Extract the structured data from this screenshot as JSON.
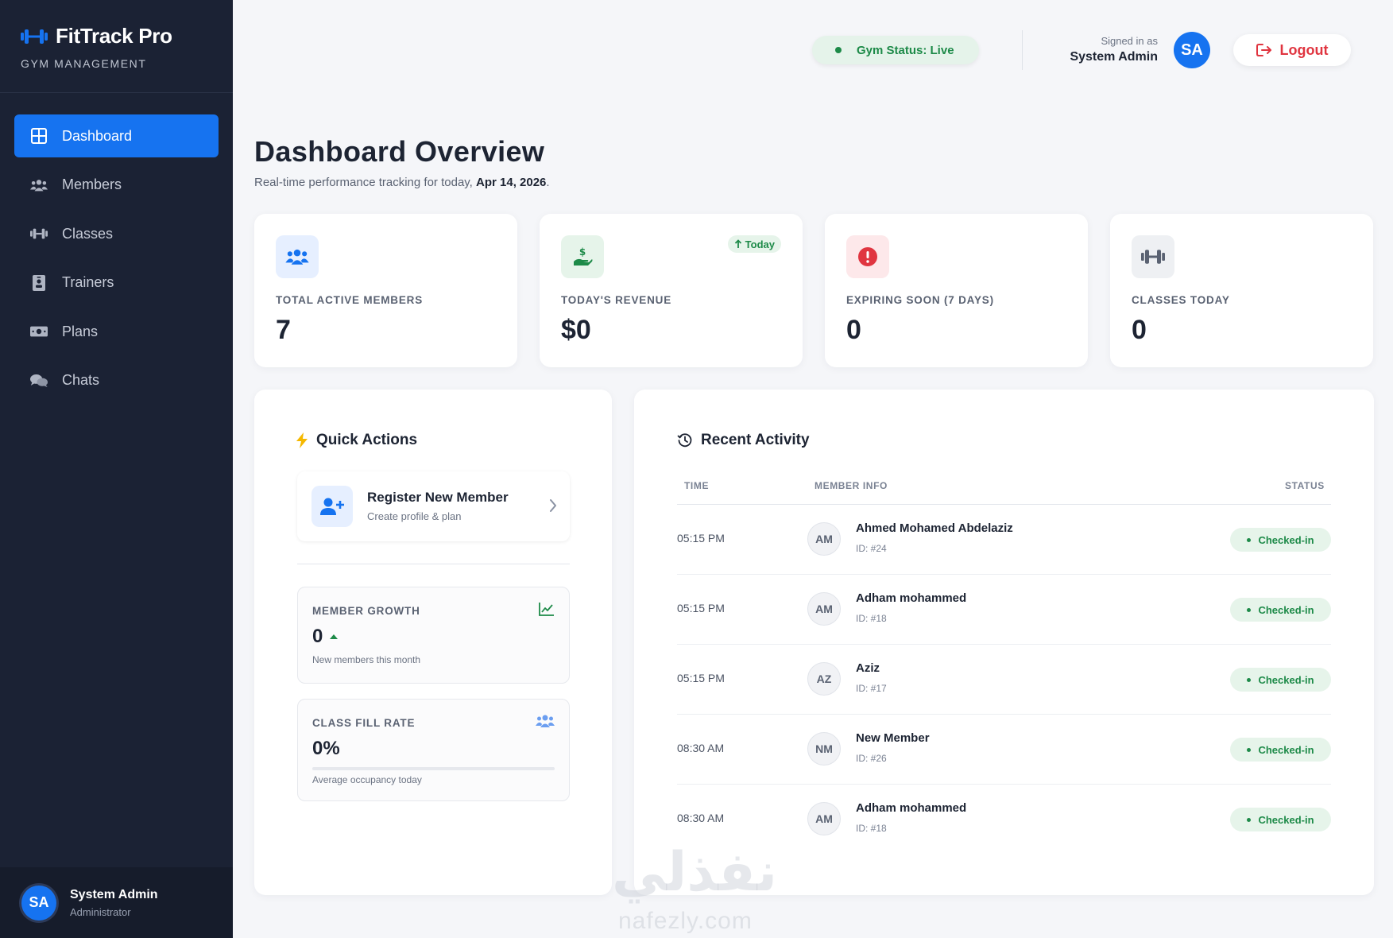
{
  "brand": {
    "title": "FitTrack Pro",
    "subtitle": "GYM MANAGEMENT"
  },
  "sidebar": {
    "items": [
      {
        "label": "Dashboard",
        "icon": "dashboard-icon",
        "active": true
      },
      {
        "label": "Members",
        "icon": "users-icon"
      },
      {
        "label": "Classes",
        "icon": "dumbbell-icon"
      },
      {
        "label": "Trainers",
        "icon": "id-badge-icon"
      },
      {
        "label": "Plans",
        "icon": "money-bill-icon"
      },
      {
        "label": "Chats",
        "icon": "comments-icon"
      }
    ],
    "user": {
      "initials": "SA",
      "name": "System Admin",
      "role": "Administrator"
    }
  },
  "header": {
    "gym_status": "Gym Status: Live",
    "signed_in_label": "Signed in as",
    "user_name": "System Admin",
    "initials": "SA",
    "logout_label": "Logout"
  },
  "page": {
    "title": "Dashboard Overview",
    "subtitle_prefix": "Real-time performance tracking for today,",
    "date": "Apr 14, 2026",
    "subtitle_suffix": "."
  },
  "stats": [
    {
      "label": "TOTAL ACTIVE MEMBERS",
      "value": "7",
      "icon": "users-icon",
      "color": "#1673f0"
    },
    {
      "label": "TODAY'S REVENUE",
      "value": "$0",
      "icon": "money-hand-icon",
      "color": "#1d8a48",
      "badge": "Today"
    },
    {
      "label": "EXPIRING SOON (7 DAYS)",
      "value": "0",
      "icon": "alert-icon",
      "color": "#e03540"
    },
    {
      "label": "CLASSES TODAY",
      "value": "0",
      "icon": "dumbbell-icon",
      "color": "#5a6272"
    }
  ],
  "quick_actions": {
    "title": "Quick Actions",
    "register": {
      "title": "Register New Member",
      "subtitle": "Create profile & plan"
    },
    "member_growth": {
      "label": "MEMBER GROWTH",
      "value": "0",
      "subtitle": "New members this month"
    },
    "class_fill": {
      "label": "CLASS FILL RATE",
      "value": "0%",
      "subtitle": "Average occupancy today",
      "progress": 0
    }
  },
  "recent_activity": {
    "title": "Recent Activity",
    "columns": [
      "TIME",
      "MEMBER INFO",
      "STATUS"
    ],
    "rows": [
      {
        "time": "05:15 PM",
        "initials": "AM",
        "name": "Ahmed Mohamed Abdelaziz",
        "id": "ID: #24",
        "status": "Checked-in"
      },
      {
        "time": "05:15 PM",
        "initials": "AM",
        "name": "Adham mohammed",
        "id": "ID: #18",
        "status": "Checked-in"
      },
      {
        "time": "05:15 PM",
        "initials": "AZ",
        "name": "Aziz",
        "id": "ID: #17",
        "status": "Checked-in"
      },
      {
        "time": "08:30 AM",
        "initials": "NM",
        "name": "New Member",
        "id": "ID: #26",
        "status": "Checked-in"
      },
      {
        "time": "08:30 AM",
        "initials": "AM",
        "name": "Adham mohammed",
        "id": "ID: #18",
        "status": "Checked-in"
      }
    ]
  },
  "watermark": {
    "arabic": "نفذلي",
    "latin": "nafezly.com"
  },
  "colors": {
    "primary": "#1673f0",
    "sidebar": "#1b2234",
    "success": "#1d8a48",
    "danger": "#e03540"
  }
}
